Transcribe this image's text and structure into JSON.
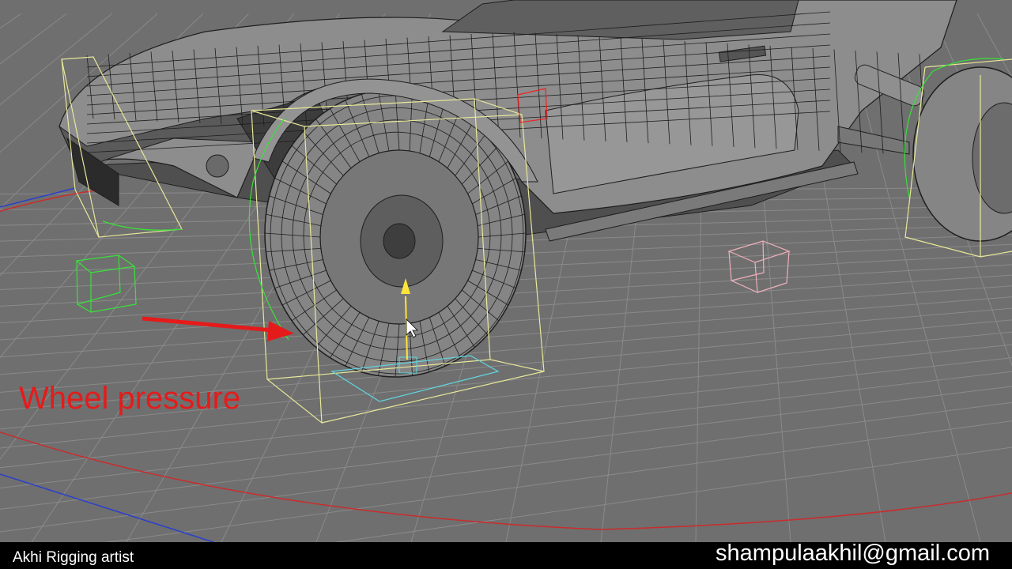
{
  "annotation": {
    "label": "Wheel pressure",
    "color": "#e51b1b"
  },
  "footer": {
    "credit": "Akhi Rigging artist",
    "email": "shampulaakhil@gmail.com"
  },
  "scene": {
    "background_color": "#6f6f6f",
    "grid_color": "#808080",
    "mesh_fill": "#8d8d8d",
    "wire_color": "#1e1e1e",
    "bounding_box_color": "#e8e79a",
    "selection_color": "#37e337",
    "x_axis_color": "#cc2b2b",
    "z_axis_color": "#2b3fcc",
    "handle_color": "#ffe43a",
    "pink_locator_color": "#f0b0bb",
    "cyan_locator_color": "#5fd6e0"
  }
}
